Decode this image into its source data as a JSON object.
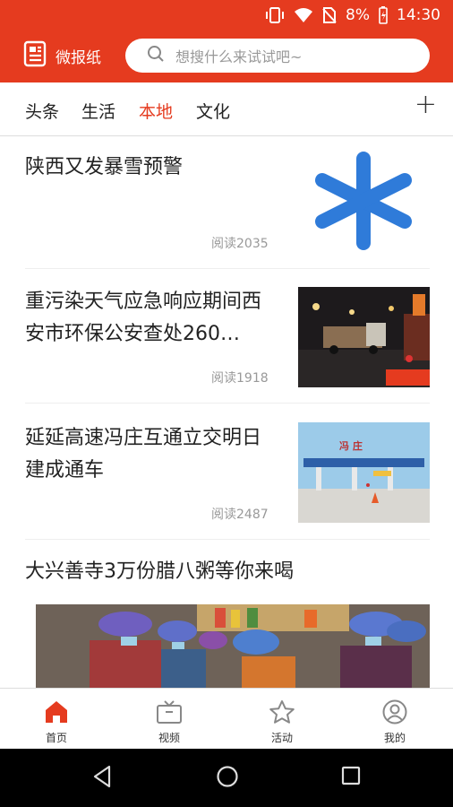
{
  "status_bar": {
    "battery": "8%",
    "time": "14:30"
  },
  "header": {
    "app_name": "微报纸",
    "search_placeholder": "想搜什么来试试吧~"
  },
  "tabs": [
    {
      "label": "头条",
      "active": false
    },
    {
      "label": "生活",
      "active": false
    },
    {
      "label": "本地",
      "active": true
    },
    {
      "label": "文化",
      "active": false
    }
  ],
  "tab_add_label": "+",
  "articles": [
    {
      "title": "陕西又发暴雪预警",
      "reads": "阅读2035",
      "thumb": "blue-asterisk"
    },
    {
      "title": "重污染天气应急响应期间西安市环保公安查处260…",
      "reads": "阅读1918",
      "thumb": "night-truck-photo"
    },
    {
      "title": "延延高速冯庄互通立交明日建成通车",
      "reads": "阅读2487",
      "thumb": "toll-gate-photo",
      "thumb_sign": "冯 庄"
    },
    {
      "title": "大兴善寺3万份腊八粥等你来喝",
      "thumb": "porridge-volunteers-photo"
    }
  ],
  "bottom_nav": [
    {
      "label": "首页",
      "icon": "home-icon",
      "active": true
    },
    {
      "label": "视频",
      "icon": "tv-icon",
      "active": false
    },
    {
      "label": "活动",
      "icon": "star-icon",
      "active": false
    },
    {
      "label": "我的",
      "icon": "profile-icon",
      "active": false
    }
  ],
  "colors": {
    "brand": "#e53b1f",
    "asterisk": "#2f7bd9"
  }
}
